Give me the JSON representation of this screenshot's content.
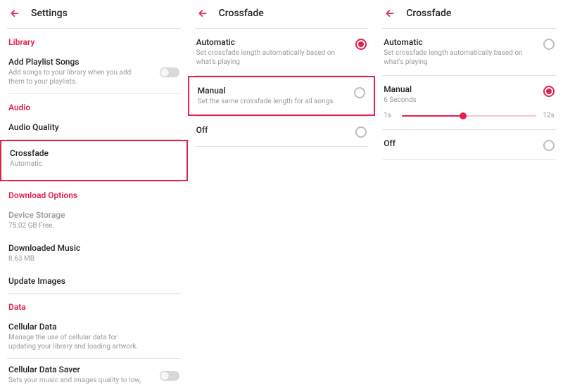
{
  "colors": {
    "accent": "#e5204c"
  },
  "col1": {
    "header": {
      "title": "Settings"
    },
    "library": {
      "heading": "Library",
      "addPlaylist": {
        "title": "Add Playlist Songs",
        "subtitle": "Add songs to your library when you add them to your playlists."
      }
    },
    "audio": {
      "heading": "Audio",
      "audioQuality": {
        "title": "Audio Quality"
      },
      "crossfade": {
        "title": "Crossfade",
        "subtitle": "Automatic"
      }
    },
    "download": {
      "heading": "Download Options",
      "storage": {
        "title": "Device Storage",
        "subtitle": "75.02 GB Free."
      },
      "downloaded": {
        "title": "Downloaded Music",
        "subtitle": "8.63 MB"
      },
      "updateImages": {
        "title": "Update Images"
      }
    },
    "data": {
      "heading": "Data",
      "cellular": {
        "title": "Cellular Data",
        "subtitle": "Manage the use of cellular data for updating your library and loading artwork."
      },
      "saver": {
        "title": "Cellular Data Saver",
        "subtitle": "Sets your music and images quality to low,"
      }
    }
  },
  "col2": {
    "header": {
      "title": "Crossfade"
    },
    "automatic": {
      "title": "Automatic",
      "subtitle": "Set crossfade length automatically based on what's playing"
    },
    "manual": {
      "title": "Manual",
      "subtitle": "Set the same crossfade length for all songs"
    },
    "off": {
      "title": "Off"
    }
  },
  "col3": {
    "header": {
      "title": "Crossfade"
    },
    "automatic": {
      "title": "Automatic",
      "subtitle": "Set crossfade length automatically based on what's playing"
    },
    "manual": {
      "title": "Manual",
      "subtitle": "6 Seconds"
    },
    "slider": {
      "min": "1s",
      "max": "12s",
      "value": 6,
      "minVal": 1,
      "maxVal": 12
    },
    "off": {
      "title": "Off"
    }
  }
}
